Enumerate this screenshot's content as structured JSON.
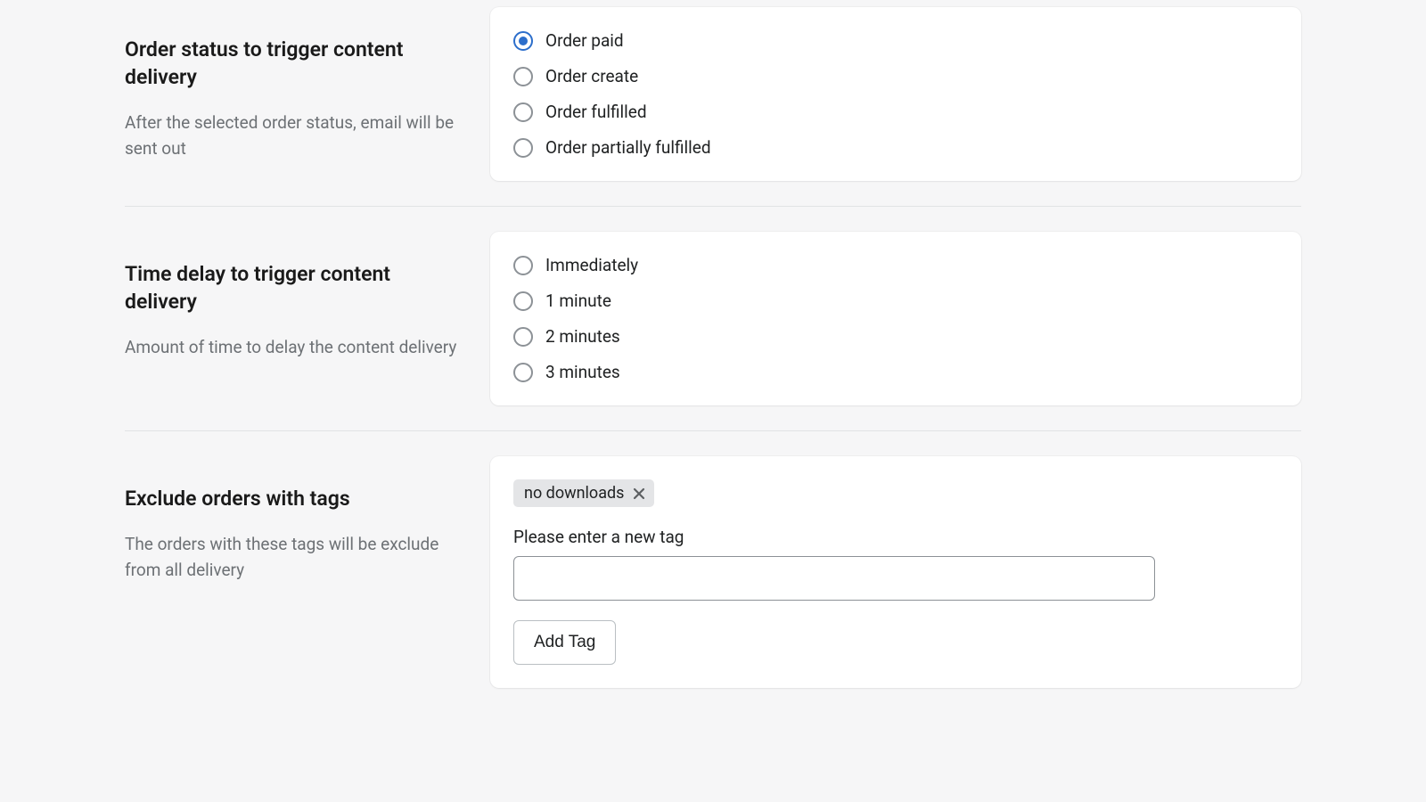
{
  "section1": {
    "title": "Order status to trigger content delivery",
    "desc": "After the selected order status, email will be sent out",
    "options": [
      {
        "label": "Order paid",
        "selected": true
      },
      {
        "label": "Order create",
        "selected": false
      },
      {
        "label": "Order fulfilled",
        "selected": false
      },
      {
        "label": "Order partially fulfilled",
        "selected": false
      }
    ]
  },
  "section2": {
    "title": "Time delay to trigger content delivery",
    "desc": "Amount of time to delay the content delivery",
    "options": [
      {
        "label": "Immediately",
        "selected": false
      },
      {
        "label": "1 minute",
        "selected": false
      },
      {
        "label": "2 minutes",
        "selected": false
      },
      {
        "label": "3 minutes",
        "selected": false
      }
    ]
  },
  "section3": {
    "title": "Exclude orders with tags",
    "desc": "The orders with these tags will be exclude from all delivery",
    "tags": [
      {
        "label": "no downloads"
      }
    ],
    "field_label": "Please enter a new tag",
    "input_value": "",
    "add_button": "Add Tag"
  }
}
